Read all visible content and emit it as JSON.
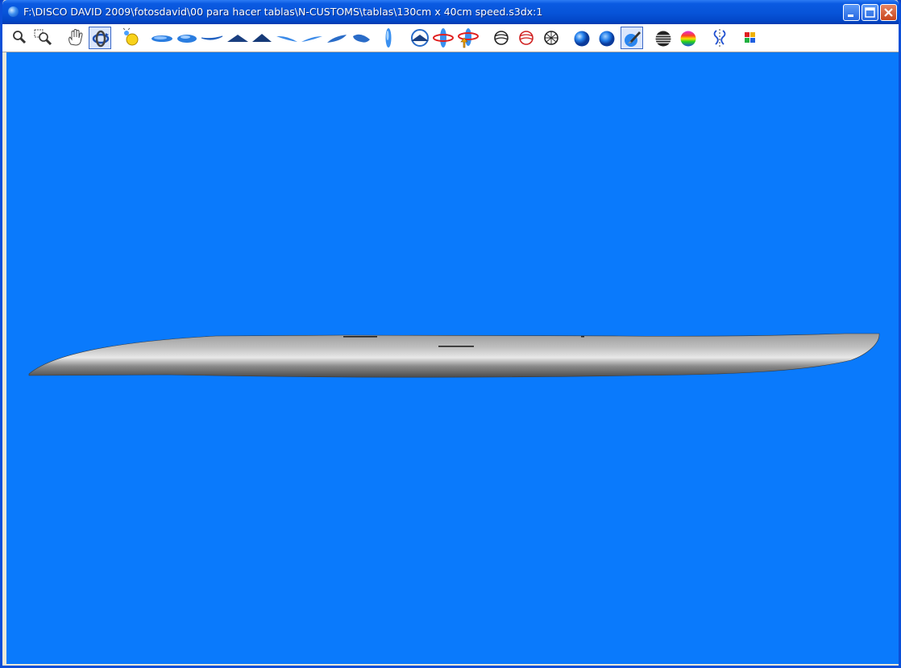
{
  "window": {
    "title": "F:\\DISCO DAVID 2009\\fotosdavid\\00 para hacer tablas\\N-CUSTOMS\\tablas\\130cm x 40cm speed.s3dx:1",
    "controls": [
      "minimize",
      "maximize",
      "close"
    ]
  },
  "toolbar": {
    "tools": [
      {
        "id": "zoom",
        "icon": "magnifier-icon"
      },
      {
        "id": "zoom-window",
        "icon": "zoom-window-icon"
      },
      {
        "id": "pan",
        "icon": "hand-icon"
      },
      {
        "id": "rotate",
        "icon": "rotate-arrows-icon",
        "active": true
      },
      {
        "id": "light",
        "icon": "light-source-icon"
      },
      {
        "id": "view-bottom",
        "icon": "board-bottom-view-icon"
      },
      {
        "id": "view-top",
        "icon": "board-top-view-icon"
      },
      {
        "id": "view-side",
        "icon": "board-side-view-icon"
      },
      {
        "id": "view-tail",
        "icon": "board-tail-view-icon"
      },
      {
        "id": "view-nose",
        "icon": "board-nose-view-icon"
      },
      {
        "id": "view-3d-1",
        "icon": "board-3d-view-1-icon"
      },
      {
        "id": "view-3d-2",
        "icon": "board-3d-view-2-icon"
      },
      {
        "id": "view-3d-3",
        "icon": "board-3d-view-3-icon"
      },
      {
        "id": "view-3d-4",
        "icon": "board-3d-view-4-icon"
      },
      {
        "id": "view-vertical",
        "icon": "board-vertical-view-icon"
      },
      {
        "id": "rotate-view",
        "icon": "rotate-view-icon"
      },
      {
        "id": "spin-board",
        "icon": "spin-board-icon"
      },
      {
        "id": "spin-up",
        "icon": "spin-up-icon"
      },
      {
        "id": "wireframe-1",
        "icon": "wireframe-sphere-icon"
      },
      {
        "id": "wireframe-2",
        "icon": "wireframe-sphere-red-icon"
      },
      {
        "id": "wireframe-3",
        "icon": "mesh-sphere-icon"
      },
      {
        "id": "shaded",
        "icon": "shaded-sphere-icon"
      },
      {
        "id": "shaded-smooth",
        "icon": "smooth-sphere-icon"
      },
      {
        "id": "render-paint",
        "icon": "paint-brush-icon",
        "active": true
      },
      {
        "id": "stripes",
        "icon": "striped-sphere-icon"
      },
      {
        "id": "curvature",
        "icon": "rainbow-sphere-icon"
      },
      {
        "id": "symmetry",
        "icon": "symmetry-icon"
      },
      {
        "id": "colors",
        "icon": "color-grid-icon"
      }
    ]
  },
  "viewport": {
    "background_color": "#0a7afc",
    "model": "board-side-profile"
  },
  "colors": {
    "titlebar": "#0754d8",
    "viewport": "#0a7afc",
    "toolbar": "#ffffff"
  }
}
